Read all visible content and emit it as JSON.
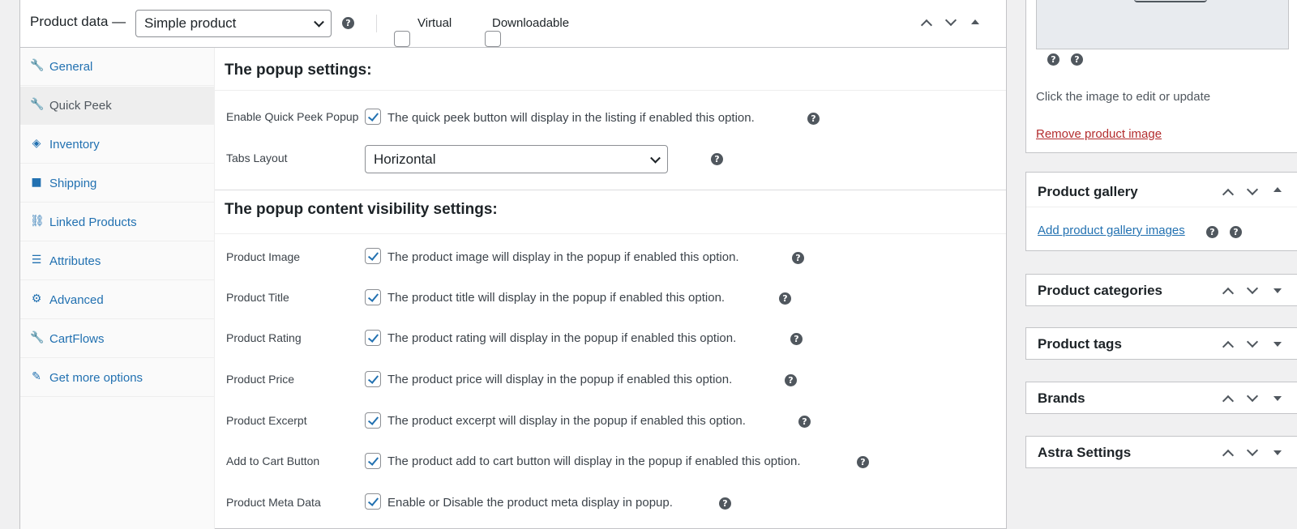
{
  "product_data": {
    "title": "Product data —",
    "product_type": "Simple product",
    "virtual_label": "Virtual",
    "downloadable_label": "Downloadable",
    "help_glyph": "?",
    "tabs": [
      {
        "label": "General",
        "icon": "wrench-icon",
        "glyph": "🔧"
      },
      {
        "label": "Quick Peek",
        "icon": "wrench-icon",
        "glyph": "🔧"
      },
      {
        "label": "Inventory",
        "icon": "tag-icon",
        "glyph": "◈"
      },
      {
        "label": "Shipping",
        "icon": "truck-icon",
        "glyph": "■"
      },
      {
        "label": "Linked Products",
        "icon": "link-icon",
        "glyph": "⛓"
      },
      {
        "label": "Attributes",
        "icon": "list-icon",
        "glyph": "☰"
      },
      {
        "label": "Advanced",
        "icon": "gear-icon",
        "glyph": "⚙"
      },
      {
        "label": "CartFlows",
        "icon": "wrench-icon",
        "glyph": "🔧"
      },
      {
        "label": "Get more options",
        "icon": "plugin-icon",
        "glyph": "✎"
      }
    ],
    "active_tab": "Quick Peek",
    "popup_settings": {
      "title": "The popup settings:",
      "enable_label": "Enable Quick Peek Popup",
      "enable_desc": "The quick peek button will display in the listing if enabled this option.",
      "tabs_layout_label": "Tabs Layout",
      "tabs_layout_value": "Horizontal"
    },
    "visibility": {
      "title": "The popup content visibility settings:",
      "rows": [
        {
          "label": "Product Image",
          "desc": "The product image will display in the popup if enabled this option.",
          "checked": true
        },
        {
          "label": "Product Title",
          "desc": "The product title will display in the popup if enabled this option.",
          "checked": true
        },
        {
          "label": "Product Rating",
          "desc": "The product rating will display in the popup if enabled this option.",
          "checked": true
        },
        {
          "label": "Product Price",
          "desc": "The product price will display in the popup if enabled this option.",
          "checked": true
        },
        {
          "label": "Product Excerpt",
          "desc": "The product excerpt will display in the popup if enabled this option.",
          "checked": true
        },
        {
          "label": "Add to Cart Button",
          "desc": "The product add to cart button will display in the popup if enabled this option.",
          "checked": true
        },
        {
          "label": "Product Meta Data",
          "desc": "Enable or Disable the product meta display in popup.",
          "checked": true
        }
      ]
    }
  },
  "product_image_box": {
    "hint": "Click the image to edit or update",
    "remove_link": "Remove product image"
  },
  "product_gallery": {
    "title": "Product gallery",
    "add_link": "Add product gallery images"
  },
  "product_categories": {
    "title": "Product categories"
  },
  "product_tags": {
    "title": "Product tags"
  },
  "brands": {
    "title": "Brands"
  },
  "astra_settings": {
    "title": "Astra Settings"
  },
  "colors": {
    "link": "#2271b1",
    "remove_link": "#b32d2e",
    "checkbox_check": "#2271b1"
  }
}
